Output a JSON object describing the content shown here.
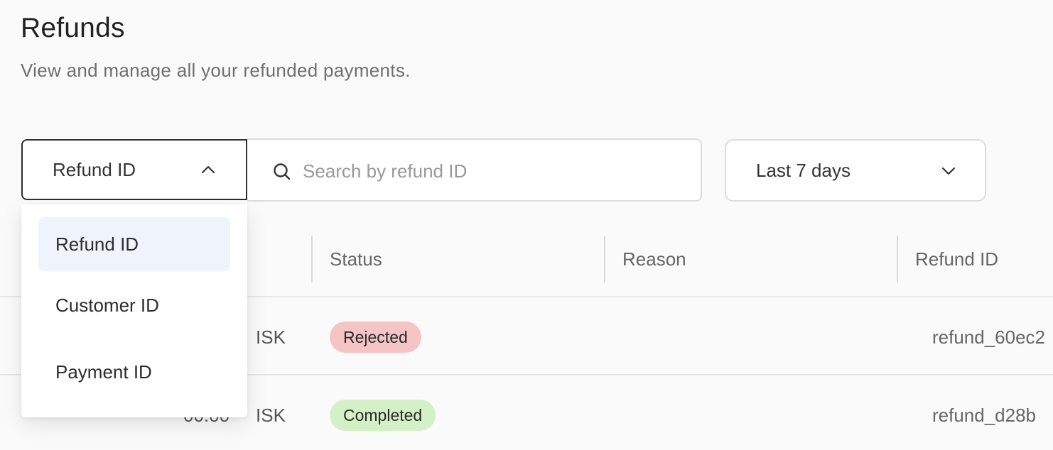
{
  "page": {
    "title": "Refunds",
    "subtitle": "View and manage all your refunded payments."
  },
  "filters": {
    "search_field_selected": "Refund ID",
    "search_placeholder": "Search by refund ID",
    "date_range": "Last 7 days"
  },
  "dropdown": {
    "options": [
      "Refund ID",
      "Customer ID",
      "Payment ID"
    ],
    "selected": "Refund ID"
  },
  "table": {
    "headers": [
      "Status",
      "Reason",
      "Refund ID"
    ],
    "rows": [
      {
        "amount": "",
        "currency": "ISK",
        "status": "Rejected",
        "reason": "",
        "refund_id": "refund_60ec2"
      },
      {
        "amount": "00.00",
        "currency": "ISK",
        "status": "Completed",
        "reason": "",
        "refund_id": "refund_d28b"
      }
    ]
  },
  "colors": {
    "rejected_badge": "#f5c4c4",
    "completed_badge": "#d4f0c6",
    "selected_option_bg": "#eff3fb"
  }
}
